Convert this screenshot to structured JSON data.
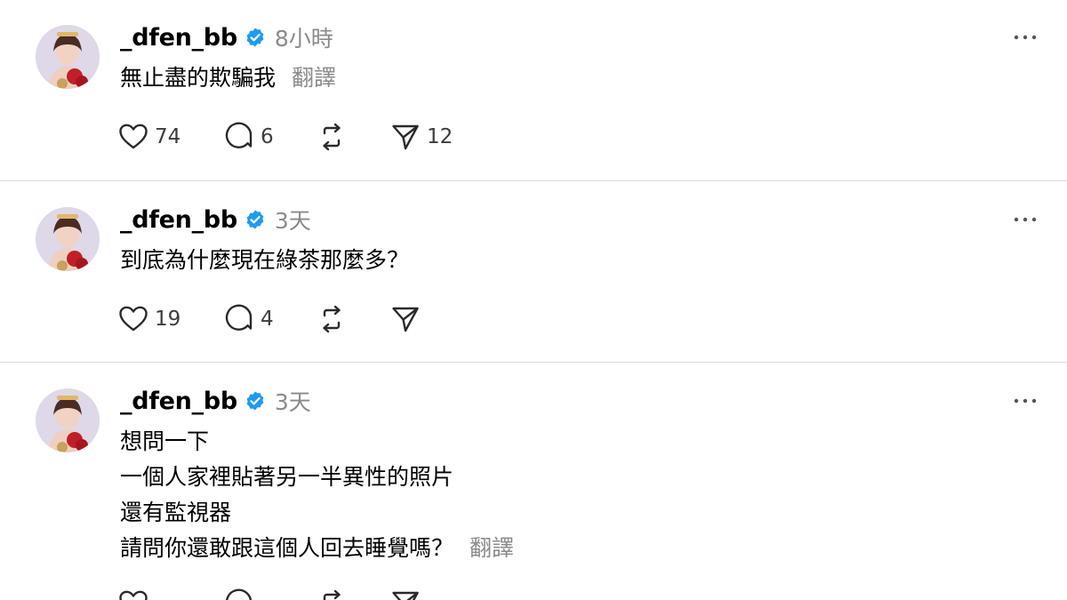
{
  "colors": {
    "background": "#ffffff",
    "text": "#000000",
    "secondary_text": "#8a8a8a",
    "divider": "#d9d9d9",
    "verified_badge": "#1d9bf0"
  },
  "icons": {
    "verified": "verified-badge-icon",
    "more": "more-options-icon",
    "like": "heart-icon",
    "reply": "comment-bubble-icon",
    "repost": "repost-arrows-icon",
    "share": "send-paper-plane-icon"
  },
  "posts": [
    {
      "username": "_dfen_bb",
      "time": "8小時",
      "lines": [
        "無止盡的欺騙我"
      ],
      "translate_label": "翻譯",
      "likes": "74",
      "replies": "6",
      "reposts": "",
      "shares": "12"
    },
    {
      "username": "_dfen_bb",
      "time": "3天",
      "lines": [
        "到底為什麼現在綠茶那麼多？"
      ],
      "translate_label": "",
      "likes": "19",
      "replies": "4",
      "reposts": "",
      "shares": ""
    },
    {
      "username": "_dfen_bb",
      "time": "3天",
      "lines": [
        "想問一下",
        "一個人家裡貼著另一半異性的照片",
        "還有監視器",
        "請問你還敢跟這個人回去睡覺嗎？"
      ],
      "translate_label": "翻譯",
      "likes": "",
      "replies": "",
      "reposts": "",
      "shares": ""
    }
  ]
}
